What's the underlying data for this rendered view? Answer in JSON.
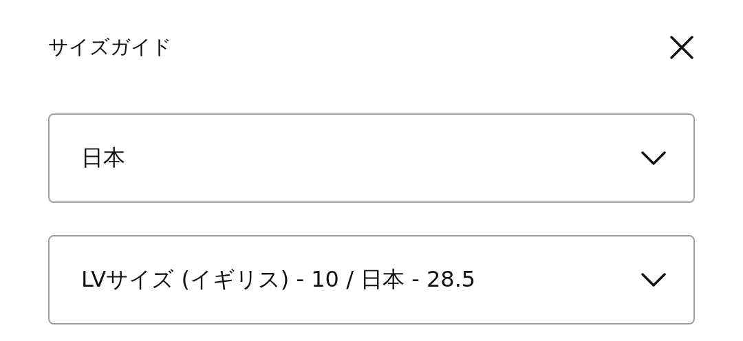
{
  "title": "サイズガイド",
  "selects": [
    {
      "value": "日本"
    },
    {
      "value": "LVサイズ (イギリス) - 10 / 日本 - 28.5"
    }
  ]
}
